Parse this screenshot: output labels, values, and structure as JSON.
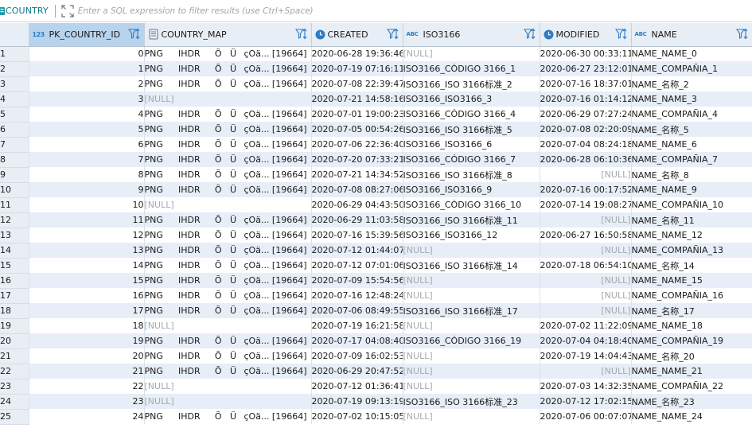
{
  "toolbar": {
    "table_name": "COUNTRY",
    "filter_placeholder": "Enter a SQL expression to filter results (use Ctrl+Space)"
  },
  "columns": [
    {
      "label": "PK_COUNTRY_ID",
      "type_icon": "numeric-type-icon",
      "type_text": "123"
    },
    {
      "label": "COUNTRY_MAP",
      "type_icon": "binary-type-icon",
      "type_text": ""
    },
    {
      "label": "CREATED",
      "type_icon": "datetime-type-icon",
      "type_text": ""
    },
    {
      "label": "ISO3166",
      "type_icon": "string-type-icon",
      "type_text": "ABC"
    },
    {
      "label": "MODIFIED",
      "type_icon": "datetime-type-icon",
      "type_text": ""
    },
    {
      "label": "NAME",
      "type_icon": "string-type-icon",
      "type_text": "ABC"
    }
  ],
  "map_parts": [
    "PNG",
    "IHDR",
    "Õ",
    "Ü",
    "çOä... [19664]"
  ],
  "null_text": "[NULL]",
  "rows": [
    {
      "n": "1",
      "id": "0",
      "map": true,
      "created": "2020-06-28 19:36:46",
      "iso": "[NULL]",
      "modified": "2020-06-30 00:33:11",
      "name": "NAME_NAME_0"
    },
    {
      "n": "2",
      "id": "1",
      "map": true,
      "created": "2020-07-19 07:16:11",
      "iso": "ISO3166_CÓDIGO 3166_1",
      "modified": "2020-06-27 23:12:01",
      "name": "NAME_COMPAÑIA_1"
    },
    {
      "n": "3",
      "id": "2",
      "map": true,
      "created": "2020-07-08 22:39:47",
      "iso": "ISO3166_ISO 3166标准_2",
      "modified": "2020-07-16 18:37:01",
      "name": "NAME_名称_2"
    },
    {
      "n": "4",
      "id": "3",
      "map": false,
      "created": "2020-07-21 14:58:16",
      "iso": "ISO3166_ISO3166_3",
      "modified": "2020-07-16 01:14:12",
      "name": "NAME_NAME_3"
    },
    {
      "n": "5",
      "id": "4",
      "map": true,
      "created": "2020-07-01 19:00:23",
      "iso": "ISO3166_CÓDIGO 3166_4",
      "modified": "2020-06-29 07:27:24",
      "name": "NAME_COMPAÑIA_4"
    },
    {
      "n": "6",
      "id": "5",
      "map": true,
      "created": "2020-07-05 00:54:26",
      "iso": "ISO3166_ISO 3166标准_5",
      "modified": "2020-07-08 02:20:09",
      "name": "NAME_名称_5"
    },
    {
      "n": "7",
      "id": "6",
      "map": true,
      "created": "2020-07-06 22:36:40",
      "iso": "ISO3166_ISO3166_6",
      "modified": "2020-07-04 08:24:18",
      "name": "NAME_NAME_6"
    },
    {
      "n": "8",
      "id": "7",
      "map": true,
      "created": "2020-07-20 07:33:21",
      "iso": "ISO3166_CÓDIGO 3166_7",
      "modified": "2020-06-28 06:10:36",
      "name": "NAME_COMPAÑIA_7"
    },
    {
      "n": "9",
      "id": "8",
      "map": true,
      "created": "2020-07-21 14:34:52",
      "iso": "ISO3166_ISO 3166标准_8",
      "modified": "[NULL]",
      "name": "NAME_名称_8"
    },
    {
      "n": "10",
      "id": "9",
      "map": true,
      "created": "2020-07-08 08:27:06",
      "iso": "ISO3166_ISO3166_9",
      "modified": "2020-07-16 00:17:52",
      "name": "NAME_NAME_9"
    },
    {
      "n": "11",
      "id": "10",
      "map": false,
      "created": "2020-06-29 04:43:50",
      "iso": "ISO3166_CÓDIGO 3166_10",
      "modified": "2020-07-14 19:08:27",
      "name": "NAME_COMPAÑIA_10"
    },
    {
      "n": "12",
      "id": "11",
      "map": true,
      "created": "2020-06-29 11:03:58",
      "iso": "ISO3166_ISO 3166标准_11",
      "modified": "[NULL]",
      "name": "NAME_名称_11"
    },
    {
      "n": "13",
      "id": "12",
      "map": true,
      "created": "2020-07-16 15:39:56",
      "iso": "ISO3166_ISO3166_12",
      "modified": "2020-06-27 16:50:58",
      "name": "NAME_NAME_12"
    },
    {
      "n": "14",
      "id": "13",
      "map": true,
      "created": "2020-07-12 01:44:07",
      "iso": "[NULL]",
      "modified": "[NULL]",
      "name": "NAME_COMPAÑIA_13"
    },
    {
      "n": "15",
      "id": "14",
      "map": true,
      "created": "2020-07-12 07:01:06",
      "iso": "ISO3166_ISO 3166标准_14",
      "modified": "2020-07-18 06:54:10",
      "name": "NAME_名称_14"
    },
    {
      "n": "16",
      "id": "15",
      "map": true,
      "created": "2020-07-09 15:54:56",
      "iso": "[NULL]",
      "modified": "[NULL]",
      "name": "NAME_NAME_15"
    },
    {
      "n": "17",
      "id": "16",
      "map": true,
      "created": "2020-07-16 12:48:24",
      "iso": "[NULL]",
      "modified": "[NULL]",
      "name": "NAME_COMPAÑIA_16"
    },
    {
      "n": "18",
      "id": "17",
      "map": true,
      "created": "2020-07-06 08:49:55",
      "iso": "ISO3166_ISO 3166标准_17",
      "modified": "[NULL]",
      "name": "NAME_名称_17"
    },
    {
      "n": "19",
      "id": "18",
      "map": false,
      "created": "2020-07-19 16:21:58",
      "iso": "[NULL]",
      "modified": "2020-07-02 11:22:09",
      "name": "NAME_NAME_18"
    },
    {
      "n": "20",
      "id": "19",
      "map": true,
      "created": "2020-07-17 04:08:40",
      "iso": "ISO3166_CÓDIGO 3166_19",
      "modified": "2020-07-04 04:18:40",
      "name": "NAME_COMPAÑIA_19"
    },
    {
      "n": "21",
      "id": "20",
      "map": true,
      "created": "2020-07-09 16:02:53",
      "iso": "[NULL]",
      "modified": "2020-07-19 14:04:43",
      "name": "NAME_名称_20"
    },
    {
      "n": "22",
      "id": "21",
      "map": true,
      "created": "2020-06-29 20:47:52",
      "iso": "[NULL]",
      "modified": "[NULL]",
      "name": "NAME_NAME_21"
    },
    {
      "n": "23",
      "id": "22",
      "map": false,
      "created": "2020-07-12 01:36:41",
      "iso": "[NULL]",
      "modified": "2020-07-03 14:32:35",
      "name": "NAME_COMPAÑIA_22"
    },
    {
      "n": "24",
      "id": "23",
      "map": false,
      "created": "2020-07-19 09:13:19",
      "iso": "ISO3166_ISO 3166标准_23",
      "modified": "2020-07-12 17:02:15",
      "name": "NAME_名称_23"
    },
    {
      "n": "25",
      "id": "24",
      "map": true,
      "created": "2020-07-02 10:15:05",
      "iso": "[NULL]",
      "modified": "2020-07-06 00:07:07",
      "name": "NAME_NAME_24"
    }
  ]
}
